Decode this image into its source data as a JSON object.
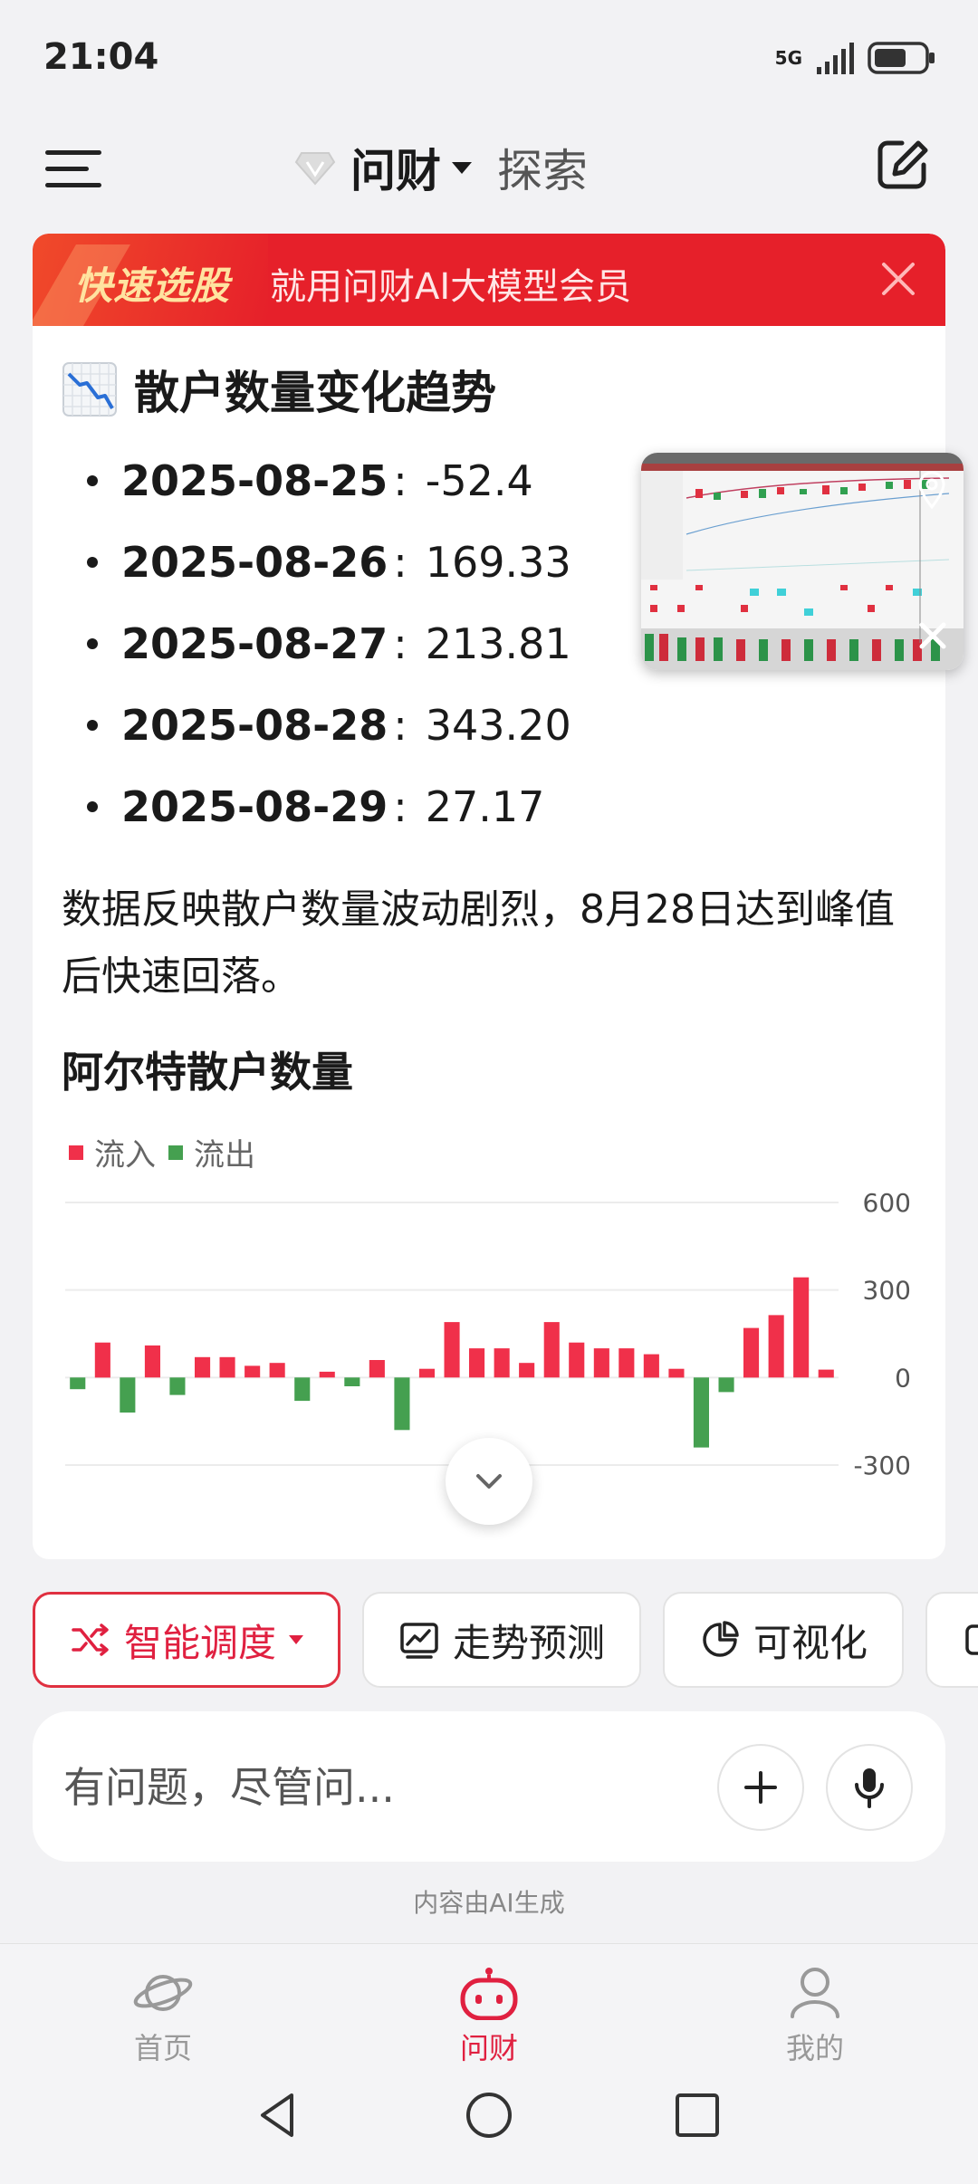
{
  "status_bar": {
    "time": "21:04",
    "network": "5G"
  },
  "nav": {
    "title": "问财",
    "explore": "探索"
  },
  "promo": {
    "title": "快速选股",
    "text": "就用问财AI大模型会员"
  },
  "section": {
    "title": "散户数量变化趋势",
    "items": [
      {
        "date": "2025-08-25",
        "value": "-52.4"
      },
      {
        "date": "2025-08-26",
        "value": "169.33"
      },
      {
        "date": "2025-08-27",
        "value": "213.81"
      },
      {
        "date": "2025-08-28",
        "value": "343.20"
      },
      {
        "date": "2025-08-29",
        "value": "27.17"
      }
    ],
    "separator": ":",
    "summary": "数据反映散户数量波动剧烈，8月28日达到峰值后快速回落。"
  },
  "chart_data": {
    "type": "bar",
    "title": "阿尔特散户数量",
    "legend": [
      "流入",
      "流出"
    ],
    "legend_placement": "top-left",
    "colors": {
      "inflow": "#f0304a",
      "outflow": "#45a050"
    },
    "y_ticks": [
      "600",
      "300",
      "0",
      "-300"
    ],
    "ylim": [
      -300,
      600
    ],
    "y_axis_side": "right",
    "grid": true,
    "values": [
      -40,
      120,
      -120,
      110,
      -60,
      70,
      70,
      40,
      50,
      -80,
      20,
      -30,
      60,
      -180,
      30,
      190,
      100,
      100,
      50,
      190,
      120,
      100,
      100,
      80,
      30,
      -240,
      -50,
      170,
      213.81,
      343.2,
      27.17
    ]
  },
  "chips": [
    {
      "label": "智能调度"
    },
    {
      "label": "走势预测"
    },
    {
      "label": "可视化"
    }
  ],
  "input": {
    "placeholder": "有问题，尽管问..."
  },
  "ai_note": "内容由AI生成",
  "bottom_nav": [
    {
      "label": "首页"
    },
    {
      "label": "问财"
    },
    {
      "label": "我的"
    }
  ]
}
